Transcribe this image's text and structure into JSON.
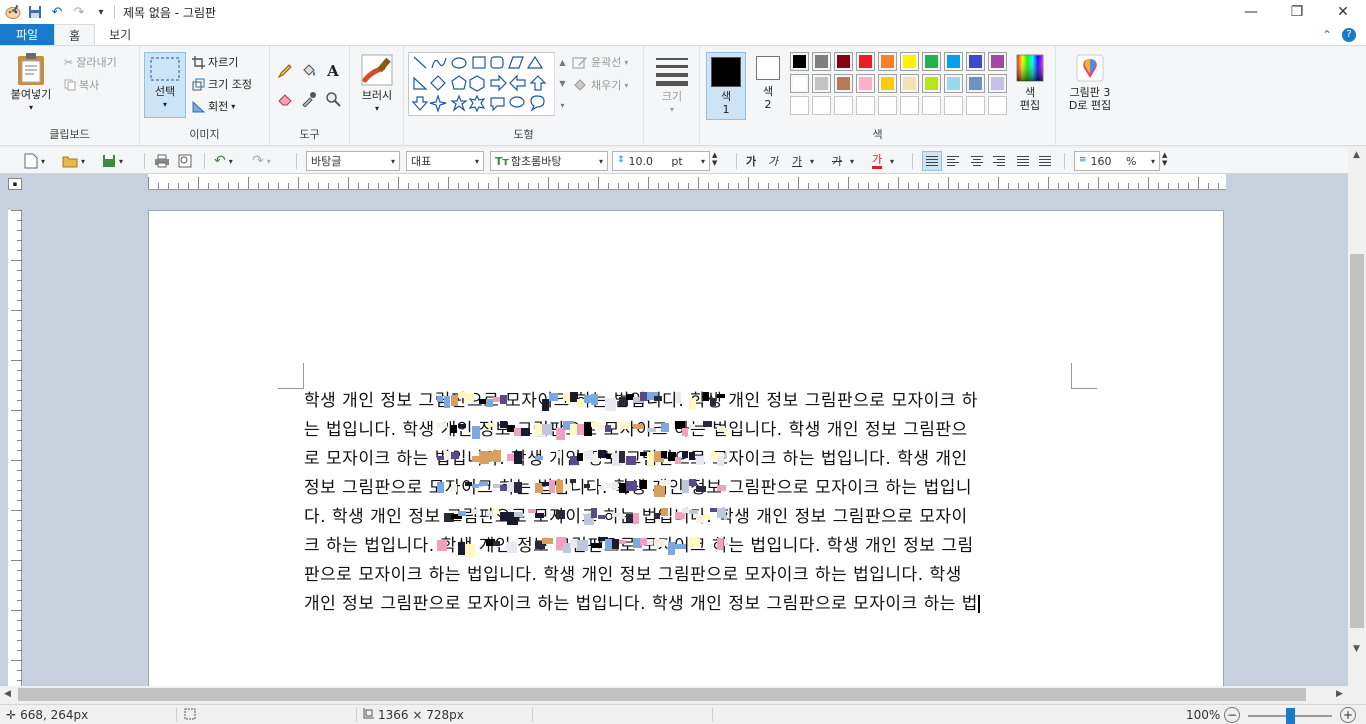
{
  "window": {
    "title": "제목 없음 - 그림판",
    "minimize": "—",
    "maximize": "❐",
    "close": "✕"
  },
  "quick_access": {
    "save": "💾",
    "undo": "↶",
    "redo": "↷",
    "customize": "▾"
  },
  "tabs": {
    "file": "파일",
    "home": "홈",
    "view": "보기"
  },
  "ribbon": {
    "clipboard": {
      "label": "클립보드",
      "paste": "붙여넣기",
      "cut": "잘라내기",
      "copy": "복사"
    },
    "image": {
      "label": "이미지",
      "select": "선택",
      "crop": "자르기",
      "resize": "크기 조정",
      "rotate": "회전"
    },
    "tools": {
      "label": "도구",
      "text_glyph": "A"
    },
    "brushes": {
      "label": "브러시"
    },
    "shapes": {
      "label": "도형",
      "outline": "윤곽선",
      "fill": "채우기"
    },
    "size": {
      "label": "크기"
    },
    "colors": {
      "label": "색",
      "color1": "색\n1",
      "color1_a": "색",
      "color1_b": "1",
      "color2_a": "색",
      "color2_b": "2",
      "edit_a": "색",
      "edit_b": "편집",
      "paint3d_a": "그림판 3",
      "paint3d_b": "D로 편집",
      "color1_value": "#000000",
      "color2_value": "#ffffff",
      "palette": [
        "#000000",
        "#7f7f7f",
        "#880015",
        "#ed1c24",
        "#ff7f27",
        "#fff200",
        "#22b14c",
        "#00a2e8",
        "#3f48cc",
        "#a349a4",
        "#ffffff",
        "#c3c3c3",
        "#b97a57",
        "#ffaec9",
        "#ffc90e",
        "#efe4b0",
        "#b5e61d",
        "#99d9ea",
        "#7092be",
        "#c8bfe7",
        "#ffffff",
        "#ffffff",
        "#ffffff",
        "#ffffff",
        "#ffffff",
        "#ffffff",
        "#ffffff",
        "#ffffff",
        "#ffffff",
        "#ffffff"
      ]
    }
  },
  "text_toolbar": {
    "style": "바탕글",
    "kind": "대표",
    "font": "함초롬바탕",
    "font_size": "10.0",
    "size_unit": "pt",
    "bold": "가",
    "italic": "가",
    "underline": "가",
    "strike": "가",
    "color": "가",
    "line_spacing": "160",
    "line_spacing_unit": "%"
  },
  "document": {
    "lines": [
      "학생 개인 정보 그림판으로 모자이크 하는 법입니다. 학생 개인 정보 그림판으로 모자이크 하",
      "는 법입니다. 학생 개인 정보 그림판으로 모자이크 하는 법입니다. 학생 개인 정보 그림판으",
      "로 모자이크 하는 법입니다. 학생 개인 정보 그림판으로 모자이크 하는 법입니다. 학생 개인",
      "정보 그림판으로 모자이크 하는 법입니다. 학생 개인 정보 그림판으로 모자이크 하는 법입니",
      "다. 학생 개인 정보 그림판으로 모자이크 하는 법입니다. 학생 개인 정보 그림판으로 모자이",
      "크 하는 법입니다. 학생 개인 정보 그림판으로 모자이크 하는 법입니다. 학생 개인 정보 그림",
      "판으로 모자이크 하는 법입니다. 학생 개인 정보 그림판으로 모자이크 하는 법입니다. 학생",
      "개인 정보 그림판으로 모자이크 하는 법입니다. 학생 개인 정보 그림판으로 모자이크 하는 법"
    ]
  },
  "status": {
    "cursor_pos": "668, 264px",
    "image_size": "1366 × 728px",
    "zoom": "100%",
    "zoom_minus": "−",
    "zoom_plus": "+",
    "zoom_level": 0.5
  }
}
